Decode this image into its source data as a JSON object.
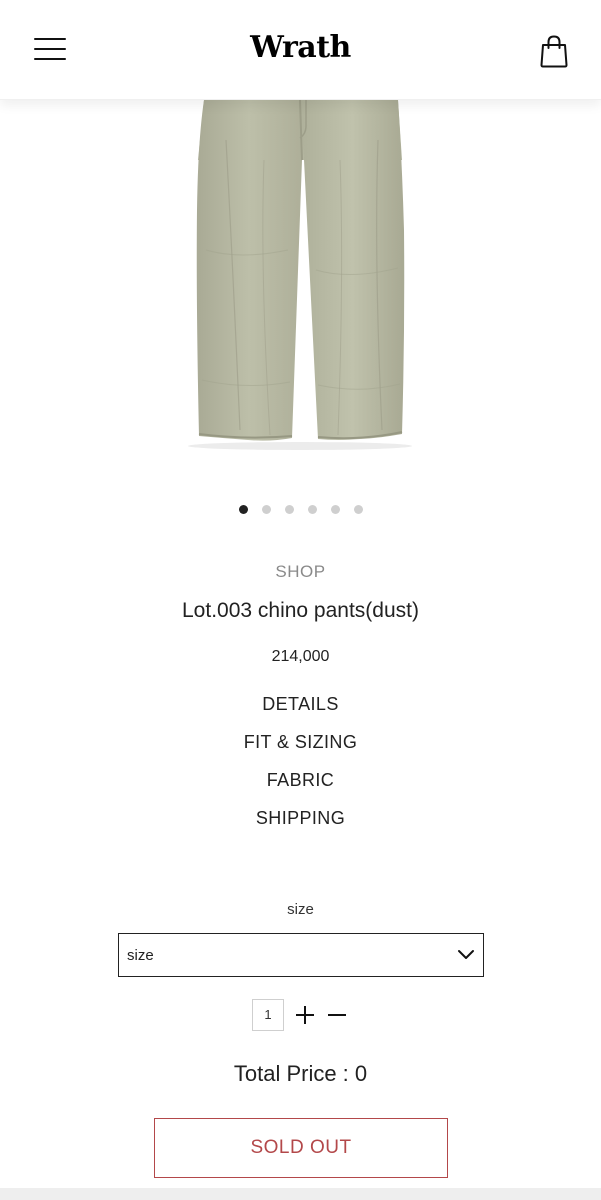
{
  "header": {
    "brand": "Wrath",
    "menu_icon": "hamburger-menu-icon",
    "cart_icon": "shopping-bag-icon"
  },
  "product": {
    "image_icon": "chino-pants-image",
    "carousel": {
      "count": 6,
      "active_index": 0
    },
    "category": "SHOP",
    "title": "Lot.003 chino pants(dust)",
    "price": "214,000"
  },
  "info_links": [
    "DETAILS",
    "FIT & SIZING",
    "FABRIC",
    "SHIPPING"
  ],
  "options": {
    "size_label": "size",
    "size_select_value": "size"
  },
  "quantity": {
    "value": "1",
    "plus_icon": "plus-icon",
    "minus_icon": "minus-icon"
  },
  "total": {
    "text": "Total Price : 0"
  },
  "cta": {
    "label": "SOLD OUT",
    "color": "#b3484a"
  }
}
